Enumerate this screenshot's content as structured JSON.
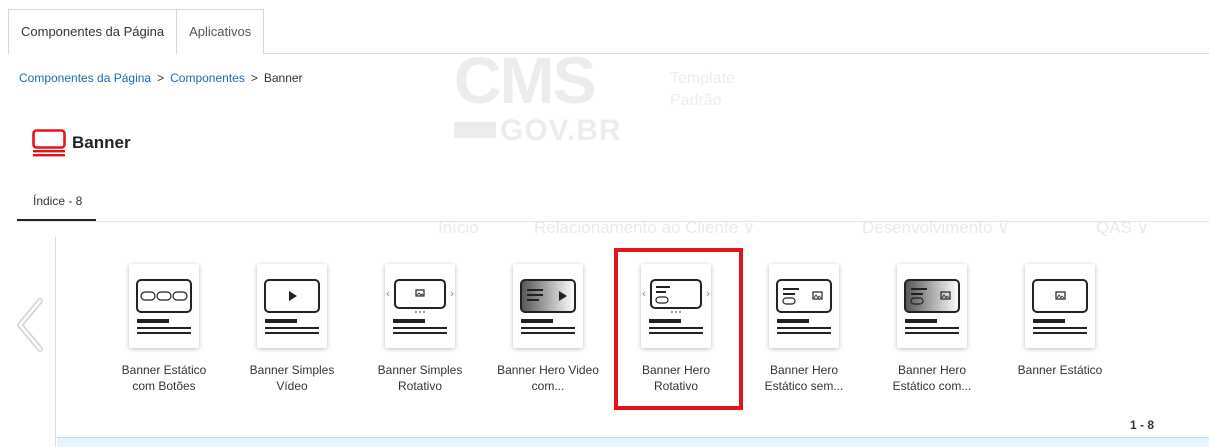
{
  "tabs": [
    {
      "label": "Componentes da Página",
      "active": true
    },
    {
      "label": "Aplicativos",
      "active": false
    }
  ],
  "breadcrumb": {
    "items": [
      "Componentes da Página",
      "Componentes",
      "Banner"
    ],
    "separator": ">"
  },
  "page": {
    "title": "Banner",
    "icon": "banner-icon"
  },
  "index_tab": {
    "label": "Índice - 8"
  },
  "cards": [
    {
      "label": "Banner Estático com Botões",
      "icon": "banner-buttons-thumb"
    },
    {
      "label": "Banner Simples Vídeo",
      "icon": "banner-video-thumb"
    },
    {
      "label": "Banner Simples Rotativo",
      "icon": "banner-rotating-thumb"
    },
    {
      "label": "Banner Hero Video com...",
      "icon": "banner-hero-video-thumb"
    },
    {
      "label": "Banner Hero Rotativo",
      "icon": "banner-hero-rotating-thumb",
      "highlighted": true
    },
    {
      "label": "Banner Hero Estático sem...",
      "icon": "banner-hero-static-thumb"
    },
    {
      "label": "Banner Hero Estático com...",
      "icon": "banner-hero-static-gradient-thumb"
    },
    {
      "label": "Banner Estático",
      "icon": "banner-static-thumb"
    }
  ],
  "pager": {
    "range": "1 - 8"
  },
  "background": {
    "logo_big": "CMS",
    "logo_small": "GOV.BR",
    "template_line1": "Template",
    "template_line2": "Padrão",
    "nav": [
      "Início",
      "Relacionamento ao Cliente ∨",
      "Desenvolvimento ∨",
      "QAS ∨"
    ]
  },
  "colors": {
    "link": "#1a6bb5",
    "highlight": "#e5131a",
    "title_icon": "#e5131a",
    "info_bar": "#e8f4fb"
  }
}
